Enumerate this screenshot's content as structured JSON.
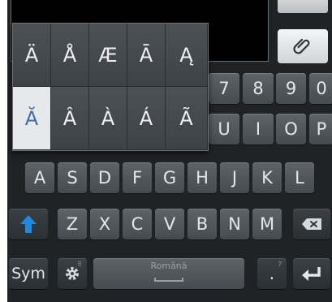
{
  "popup": {
    "row1": [
      "Ä",
      "Å",
      "Æ",
      "Ā",
      "Ą"
    ],
    "row2": [
      "Ă",
      "Â",
      "À",
      "Á",
      "Ã"
    ],
    "selected": "Ă"
  },
  "keyboard": {
    "digits_visible": [
      "7",
      "8",
      "9",
      "0"
    ],
    "row_qwerty_visible": [
      "U",
      "I",
      "O",
      "P"
    ],
    "row_asdf": [
      "A",
      "S",
      "D",
      "F",
      "G",
      "H",
      "J",
      "K",
      "L"
    ],
    "row_zxcv": [
      "Z",
      "X",
      "C",
      "V",
      "B",
      "N",
      "M"
    ],
    "sym_label": "Sym",
    "space_label": "Română",
    "period_label": ".",
    "period_hint": "?",
    "gear_hint": "⠿",
    "colors": {
      "shift_arrow": "#1e8be0",
      "key_text": "#e4e7ea",
      "selected_text": "#3f6ea8"
    },
    "icons": [
      "shift-icon",
      "backspace-icon",
      "settings-gear-icon",
      "enter-icon",
      "paperclip-icon"
    ]
  }
}
